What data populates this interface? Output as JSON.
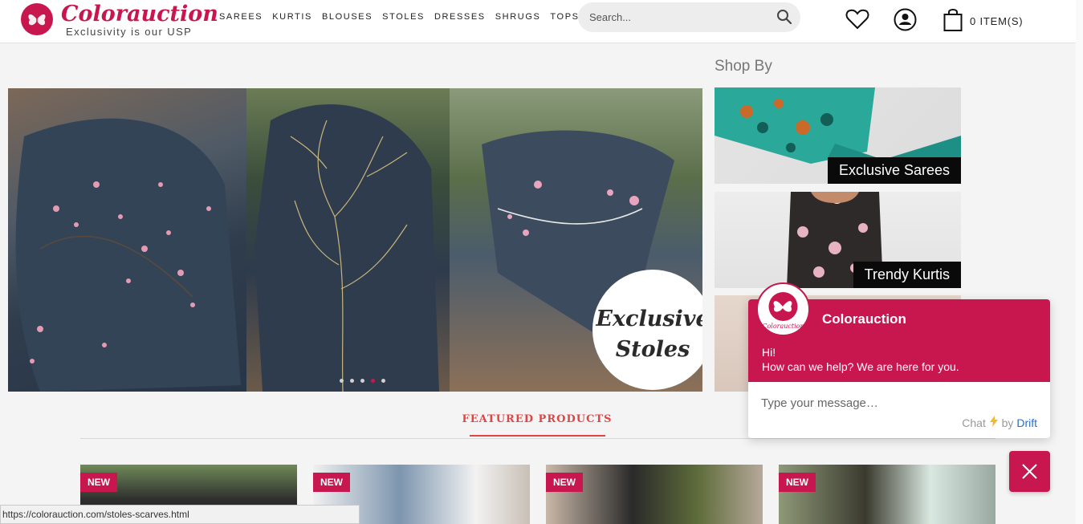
{
  "brand": {
    "name": "Colorauction",
    "tagline": "Exclusivity is our USP",
    "accent": "#c8174f"
  },
  "nav": {
    "items": [
      "SAREES",
      "KURTIS",
      "BLOUSES",
      "STOLES",
      "DRESSES",
      "SHRUGS",
      "TOPS"
    ]
  },
  "search": {
    "placeholder": "Search...",
    "icon": "search-icon"
  },
  "header_icons": {
    "wishlist": "heart-icon",
    "account": "user-icon",
    "cart": "shopping-bag-icon"
  },
  "cart": {
    "label": "0 ITEM(S)"
  },
  "banner": {
    "badge_line1": "Exclusive",
    "badge_line2": "Stoles",
    "slide_count": 5,
    "active_slide": 4
  },
  "shop_by": {
    "title": "Shop By",
    "tiles": [
      "Exclusive Sarees",
      "Trendy Kurtis"
    ]
  },
  "featured": {
    "title": "FEATURED PRODUCTS",
    "products": [
      {
        "badge": "NEW"
      },
      {
        "badge": "NEW"
      },
      {
        "badge": "NEW"
      },
      {
        "badge": "NEW"
      }
    ]
  },
  "chat": {
    "brand": "Colorauction",
    "greeting_line1": "Hi!",
    "greeting_line2": "How can we help? We are here for you.",
    "input_placeholder": "Type your message…",
    "powered_prefix": "Chat",
    "powered_by": "by",
    "powered_vendor": "Drift"
  },
  "statusbar": {
    "url": "https://colorauction.com/stoles-scarves.html"
  }
}
